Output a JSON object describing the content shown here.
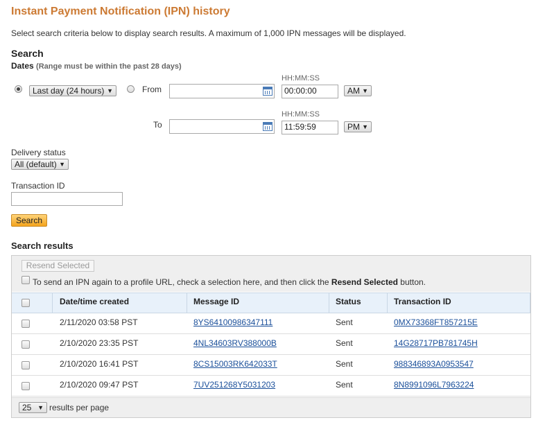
{
  "page": {
    "title": "Instant Payment Notification (IPN) history",
    "intro": "Select search criteria below to display search results. A maximum of 1,000 IPN messages will be displayed."
  },
  "search": {
    "heading": "Search",
    "dates_label": "Dates",
    "dates_hint": "(Range must be within the past 28 days)",
    "range_option": "Last day (24 hours)",
    "from_label": "From",
    "to_label": "To",
    "time_format": "HH:MM:SS",
    "from_date": "",
    "from_time": "00:00:00",
    "from_ampm": "AM",
    "to_date": "",
    "to_time": "11:59:59",
    "to_ampm": "PM",
    "delivery_label": "Delivery status",
    "delivery_value": "All (default)",
    "txn_label": "Transaction ID",
    "txn_value": "",
    "search_button": "Search"
  },
  "results": {
    "heading": "Search results",
    "resend_button": "Resend Selected",
    "note_pre": "To send an IPN again to a profile URL, check a selection here, and then click the ",
    "note_bold": "Resend Selected",
    "note_post": " button.",
    "columns": [
      "Date/time created",
      "Message ID",
      "Status",
      "Transaction ID"
    ],
    "rows": [
      {
        "date": "2/11/2020 03:58 PST",
        "message_id": "8YS64100986347111",
        "status": "Sent",
        "transaction_id": "0MX73368FT857215E"
      },
      {
        "date": "2/10/2020 23:35 PST",
        "message_id": "4NL34603RV388000B",
        "status": "Sent",
        "transaction_id": "14G28717PB781745H"
      },
      {
        "date": "2/10/2020 16:41 PST",
        "message_id": "8CS15003RK642033T",
        "status": "Sent",
        "transaction_id": "988346893A0953547"
      },
      {
        "date": "2/10/2020 09:47 PST",
        "message_id": "7UV251268Y5031203",
        "status": "Sent",
        "transaction_id": "8N8991096L7963224"
      }
    ],
    "per_page_value": "25",
    "per_page_label": "results per page"
  },
  "colors": {
    "title": "#cc7a33",
    "link": "#1a4f9a",
    "header_bg": "#e8f1fa",
    "button": "#f4a41c"
  }
}
